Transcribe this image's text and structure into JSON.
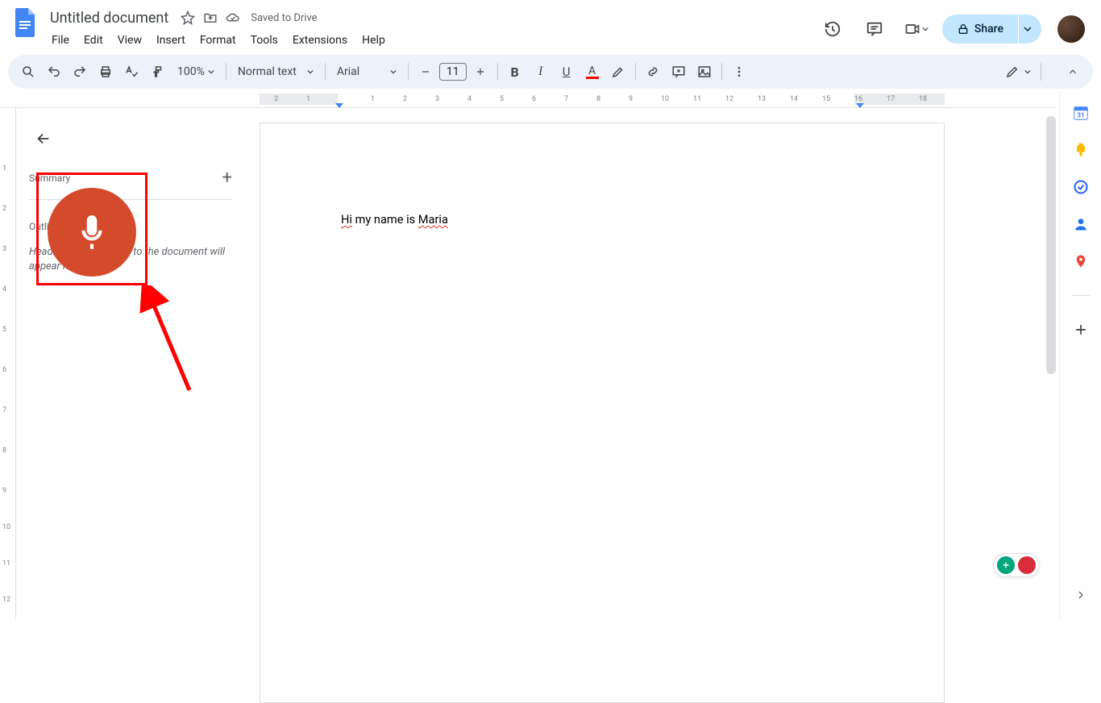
{
  "header": {
    "doc_title": "Untitled document",
    "save_status": "Saved to Drive",
    "menus": [
      "File",
      "Edit",
      "View",
      "Insert",
      "Format",
      "Tools",
      "Extensions",
      "Help"
    ],
    "share_label": "Share"
  },
  "toolbar": {
    "zoom": "100%",
    "style_name": "Normal text",
    "font_name": "Arial",
    "font_size": "11"
  },
  "outline": {
    "summary_label": "Summary",
    "outline_label": "Outline",
    "placeholder": "Headings that you add to the document will appear here."
  },
  "document": {
    "body_text_parts": {
      "p1": "Hi",
      "p2": " my name is ",
      "p3": "Maria"
    }
  },
  "ruler_h_numbers": [
    "2",
    "1",
    "",
    "1",
    "2",
    "3",
    "4",
    "5",
    "6",
    "7",
    "8",
    "9",
    "10",
    "11",
    "12",
    "13",
    "14",
    "15",
    "16",
    "17",
    "18"
  ],
  "ruler_v_numbers": [
    "",
    "1",
    "2",
    "3",
    "4",
    "5",
    "6",
    "7",
    "8",
    "9",
    "10",
    "11",
    "12"
  ]
}
